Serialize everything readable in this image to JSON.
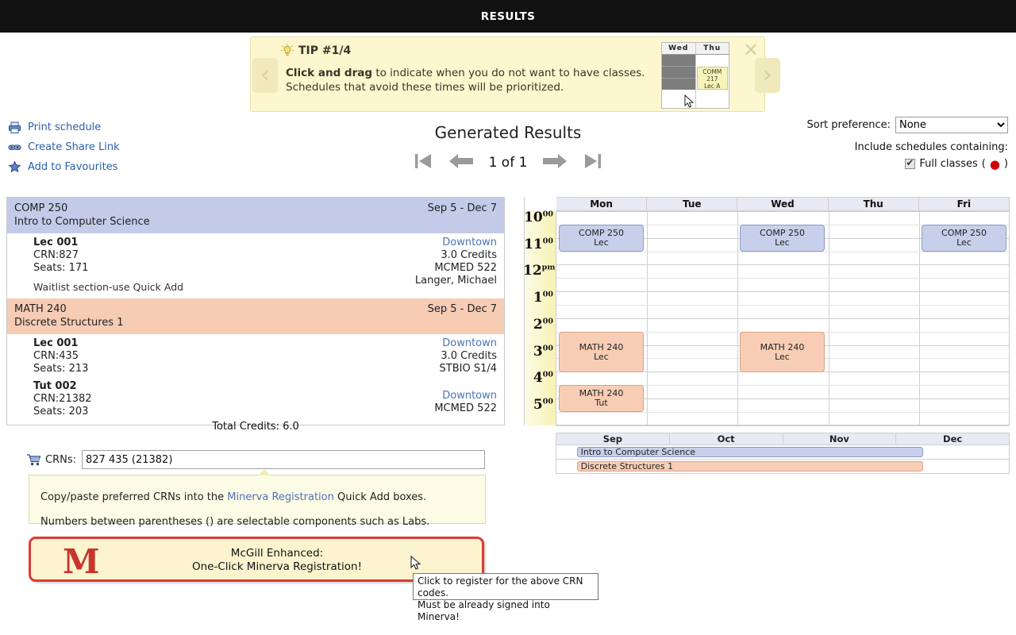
{
  "window": {
    "title": "RESULTS"
  },
  "tip": {
    "counter": "TIP #1/4",
    "body_bold": "Click and drag",
    "body_rest": " to indicate when you do not want to have classes. Schedules that avoid these times will be prioritized.",
    "prev_label": "‹",
    "next_label": "›",
    "close_label": "✕",
    "preview": {
      "day1": "Wed",
      "day2": "Thu",
      "event": "COMM 217 Lec A",
      "event_line1": "COMM",
      "event_line2": "217",
      "event_line3": "Lec A"
    }
  },
  "actions": [
    {
      "label": "Print schedule",
      "icon": "printer-icon"
    },
    {
      "label": "Create Share Link",
      "icon": "link-icon"
    },
    {
      "label": "Add to Favourites",
      "icon": "star-icon"
    }
  ],
  "header": {
    "title": "Generated Results",
    "page_indicator": "1 of 1",
    "first_label": "first-page",
    "prev_label": "previous-page",
    "next_label": "next-page",
    "last_label": "last-page"
  },
  "sort": {
    "label": "Sort preference:",
    "value": "None",
    "options": [
      "None"
    ]
  },
  "include": {
    "label": "Include schedules containing:",
    "full_classes_label": "Full classes",
    "full_classes_checked": true,
    "dot": "●",
    "open_paren": "(",
    "close_paren": ")"
  },
  "courses": [
    {
      "code": "COMP 250",
      "title": "Intro to Computer Science",
      "dates": "Sep 5 - Dec 7",
      "color": "blue",
      "sections": [
        {
          "name": "Lec 001",
          "crn": "CRN:827",
          "seats": "Seats: 171",
          "campus": "Downtown",
          "credits": "3.0 Credits",
          "room": "MCMED 522",
          "instructor": "Langer, Michael"
        }
      ],
      "note": "Waitlist section-use Quick Add"
    },
    {
      "code": "MATH 240",
      "title": "Discrete Structures 1",
      "dates": "Sep 5 - Dec 7",
      "color": "peach",
      "sections": [
        {
          "name": "Lec 001",
          "crn": "CRN:435",
          "seats": "Seats: 213",
          "campus": "Downtown",
          "credits": "3.0 Credits",
          "room": "STBIO S1/4",
          "instructor": ""
        },
        {
          "name": "Tut 002",
          "crn": "CRN:21382",
          "seats": "Seats: 203",
          "campus": "Downtown",
          "credits": "",
          "room": "MCMED 522",
          "instructor": ""
        }
      ],
      "note": ""
    }
  ],
  "total_credits": "Total Credits: 6.0",
  "crn": {
    "icon": "cart-icon",
    "label": "CRNs:",
    "value": "827 435 (21382)",
    "placeholder": "",
    "tip_line1_a": "Copy/paste preferred CRNs into the ",
    "tip_line1_link": "Minerva Registration",
    "tip_line1_b": " Quick Add boxes.",
    "tip_line2": "Numbers between parentheses () are selectable components such as Labs."
  },
  "minerva": {
    "logo": "M",
    "line1": "McGill Enhanced:",
    "line2": "One-Click Minerva Registration!",
    "tooltip_line1": "Click to register for the above CRN codes.",
    "tooltip_line2": "Must be already signed into Minerva!"
  },
  "calendar": {
    "days": [
      "Mon",
      "Tue",
      "Wed",
      "Thu",
      "Fri"
    ],
    "hours": [
      {
        "h": "10",
        "sup": "00"
      },
      {
        "h": "11",
        "sup": "00"
      },
      {
        "h": "12",
        "sup": "pm"
      },
      {
        "h": "1",
        "sup": "00"
      },
      {
        "h": "2",
        "sup": "00"
      },
      {
        "h": "3",
        "sup": "00"
      },
      {
        "h": "4",
        "sup": "00"
      },
      {
        "h": "5",
        "sup": "00"
      }
    ],
    "events": [
      {
        "day": 0,
        "start": 10.5,
        "end": 11.5,
        "line1": "COMP 250",
        "line2": "Lec",
        "color": "blue"
      },
      {
        "day": 2,
        "start": 10.5,
        "end": 11.5,
        "line1": "COMP 250",
        "line2": "Lec",
        "color": "blue"
      },
      {
        "day": 4,
        "start": 10.5,
        "end": 11.5,
        "line1": "COMP 250",
        "line2": "Lec",
        "color": "blue"
      },
      {
        "day": 0,
        "start": 14.5,
        "end": 16.0,
        "line1": "MATH 240",
        "line2": "Lec",
        "color": "peach"
      },
      {
        "day": 2,
        "start": 14.5,
        "end": 16.0,
        "line1": "MATH 240",
        "line2": "Lec",
        "color": "peach"
      },
      {
        "day": 0,
        "start": 16.5,
        "end": 17.5,
        "line1": "MATH 240",
        "line2": "Tut",
        "color": "peach"
      }
    ]
  },
  "timeline": {
    "months": [
      "Sep",
      "Oct",
      "Nov",
      "Dec"
    ],
    "rows": [
      {
        "label": "Intro to Computer Science",
        "color": "blue",
        "left_pct": 4.5,
        "width_pct": 76.5
      },
      {
        "label": "Discrete Structures 1",
        "color": "peach",
        "left_pct": 4.5,
        "width_pct": 76.5
      }
    ]
  }
}
